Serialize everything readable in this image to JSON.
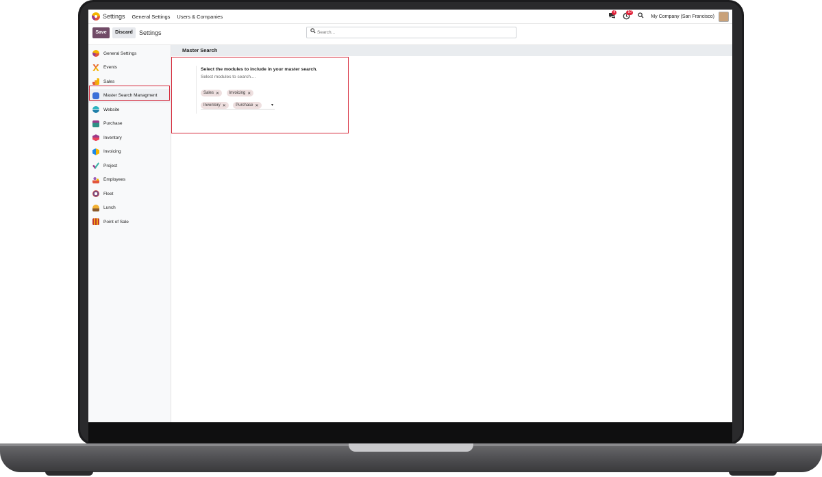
{
  "navbar": {
    "app_name": "Settings",
    "links": [
      "General Settings",
      "Users & Companies"
    ],
    "messages_count": "4",
    "activities_count": "10",
    "company": "My Company (San Francisco)"
  },
  "control_panel": {
    "save_label": "Save",
    "discard_label": "Discard",
    "title": "Settings",
    "search_placeholder": "Search..."
  },
  "sidebar": {
    "items": [
      {
        "label": "General Settings",
        "icon": "odoo-logo-icon",
        "color": "#e2553d"
      },
      {
        "label": "Events",
        "icon": "events-icon",
        "color": "#e8692e"
      },
      {
        "label": "Sales",
        "icon": "sales-icon",
        "color": "#f0a21b"
      },
      {
        "label": "Master Search Managment",
        "icon": "master-search-icon",
        "color": "#3a6fd8"
      },
      {
        "label": "Website",
        "icon": "website-icon",
        "color": "#2ab3c0"
      },
      {
        "label": "Purchase",
        "icon": "purchase-icon",
        "color": "#2f8f85"
      },
      {
        "label": "Inventory",
        "icon": "inventory-icon",
        "color": "#e8435a"
      },
      {
        "label": "Invoicing",
        "icon": "invoicing-icon",
        "color": "#1e88e5"
      },
      {
        "label": "Project",
        "icon": "project-icon",
        "color": "#3fb3a8"
      },
      {
        "label": "Employees",
        "icon": "employees-icon",
        "color": "#9c5bb5"
      },
      {
        "label": "Fleet",
        "icon": "fleet-icon",
        "color": "#7e4a7b"
      },
      {
        "label": "Lunch",
        "icon": "lunch-icon",
        "color": "#f2b134"
      },
      {
        "label": "Point of Sale",
        "icon": "point-of-sale-icon",
        "color": "#c0392b"
      }
    ],
    "active_index": 3
  },
  "main": {
    "section_title": "Master Search",
    "setting_title": "Select the modules to include in your master search.",
    "setting_help": "Select modules to search....",
    "selected_modules": [
      "Sales",
      "Invoicing",
      "Inventory",
      "Purchase"
    ]
  },
  "colors": {
    "primary": "#714b67",
    "highlight": "#d62839",
    "tag_bg": "#eedfdf"
  }
}
